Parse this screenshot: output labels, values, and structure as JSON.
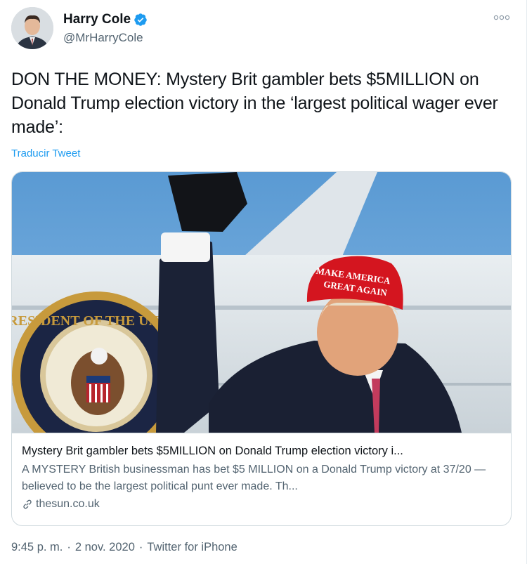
{
  "author": {
    "display_name": "Harry Cole",
    "handle": "@MrHarryCole",
    "verified": true
  },
  "tweet": {
    "text": "DON THE MONEY: Mystery Brit gambler bets $5MILLION on Donald Trump election victory in the ‘largest political wager ever made’:",
    "translate_label": "Traducir Tweet"
  },
  "card": {
    "title": "Mystery Brit gambler bets $5MILLION on Donald Trump election victory i...",
    "description": "A MYSTERY British businessman has bet $5 MILLION on a Donald Trump victory at 37/20 — believed to be the largest political punt ever made. Th...",
    "domain": "thesun.co.uk",
    "image": {
      "hat_line1": "MAKE AMERICA",
      "hat_line2": "GREAT AGAIN",
      "seal_text": "PRESIDENT OF THE UNITED"
    }
  },
  "meta": {
    "time": "9:45 p. m.",
    "separator1": "·",
    "date": "2 nov. 2020",
    "separator2": "·",
    "source": "Twitter for iPhone"
  },
  "colors": {
    "accent": "#1d9bf0",
    "secondary_text": "#536471",
    "border": "#cfd9de"
  }
}
